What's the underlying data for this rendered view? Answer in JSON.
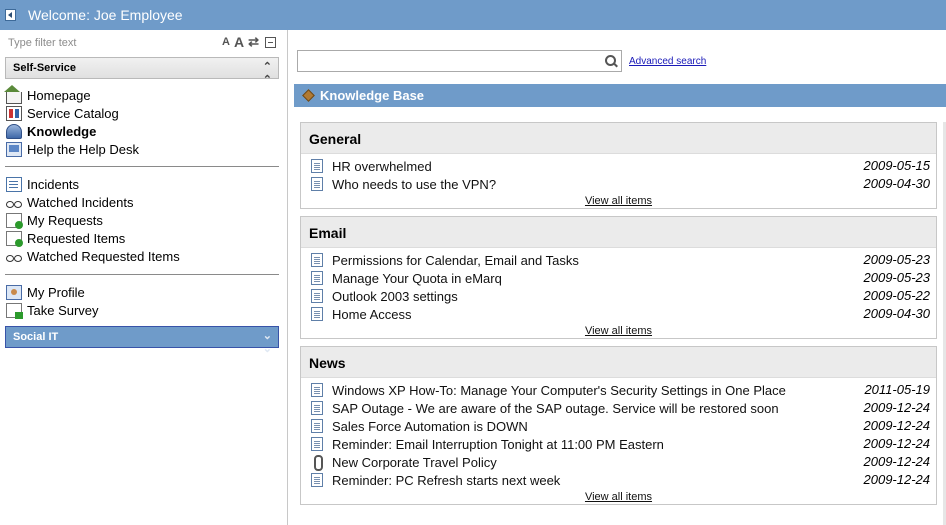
{
  "header": {
    "welcome": "Welcome: Joe Employee"
  },
  "nav": {
    "filter_placeholder": "Type filter text",
    "filter_icons": {
      "smaller": "A",
      "larger": "A",
      "refresh": "⇄"
    },
    "self_service_header": "Self-Service",
    "group1": [
      {
        "label": "Homepage",
        "icon": "home-icon"
      },
      {
        "label": "Service Catalog",
        "icon": "catalog-icon"
      },
      {
        "label": "Knowledge",
        "icon": "knowledge-icon"
      },
      {
        "label": "Help the Help Desk",
        "icon": "help-desk-icon"
      }
    ],
    "group2": [
      {
        "label": "Incidents",
        "icon": "list-icon"
      },
      {
        "label": "Watched Incidents",
        "icon": "glasses-icon"
      },
      {
        "label": "My Requests",
        "icon": "request-icon"
      },
      {
        "label": "Requested Items",
        "icon": "request-icon"
      },
      {
        "label": "Watched Requested Items",
        "icon": "glasses-icon"
      }
    ],
    "group3": [
      {
        "label": "My Profile",
        "icon": "profile-icon"
      },
      {
        "label": "Take Survey",
        "icon": "survey-icon"
      }
    ],
    "social_header": "Social IT"
  },
  "search": {
    "placeholder": "",
    "advanced_label": "Advanced search"
  },
  "kb": {
    "title": "Knowledge Base",
    "view_all": "View all items",
    "sections": [
      {
        "name": "General",
        "items": [
          {
            "title": "HR overwhelmed",
            "date": "2009-05-15",
            "icon": "document-icon"
          },
          {
            "title": "Who needs to use the VPN?",
            "date": "2009-04-30",
            "icon": "document-icon"
          }
        ]
      },
      {
        "name": "Email",
        "items": [
          {
            "title": "Permissions for Calendar, Email and Tasks",
            "date": "2009-05-23",
            "icon": "document-icon"
          },
          {
            "title": "Manage Your Quota in eMarq",
            "date": "2009-05-23",
            "icon": "document-icon"
          },
          {
            "title": "Outlook 2003 settings",
            "date": "2009-05-22",
            "icon": "document-icon"
          },
          {
            "title": "Home Access",
            "date": "2009-04-30",
            "icon": "document-icon"
          }
        ]
      },
      {
        "name": "News",
        "items": [
          {
            "title": "Windows XP How-To: Manage Your Computer's Security Settings in One Place",
            "date": "2011-05-19",
            "icon": "document-icon"
          },
          {
            "title": "SAP Outage - We are aware of the SAP outage. Service will be restored soon",
            "date": "2009-12-24",
            "icon": "document-icon"
          },
          {
            "title": "Sales Force Automation is DOWN",
            "date": "2009-12-24",
            "icon": "document-icon"
          },
          {
            "title": "Reminder: Email Interruption Tonight at 11:00 PM Eastern",
            "date": "2009-12-24",
            "icon": "document-icon"
          },
          {
            "title": "New Corporate Travel Policy",
            "date": "2009-12-24",
            "icon": "paperclip-icon"
          },
          {
            "title": "Reminder: PC Refresh starts next week",
            "date": "2009-12-24",
            "icon": "document-icon"
          }
        ]
      }
    ]
  },
  "colors": {
    "banner": "#6f9bc9",
    "section_bg": "#ebebeb",
    "link": "#1a1ab8"
  }
}
